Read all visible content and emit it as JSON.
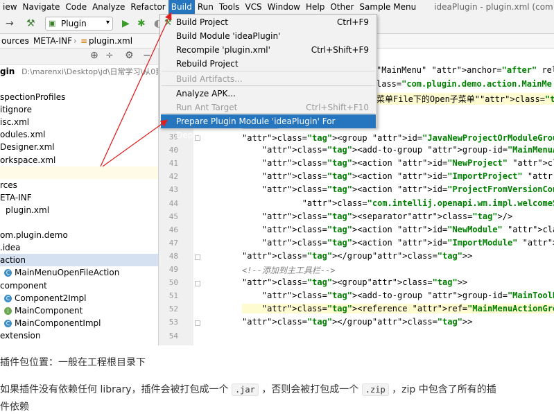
{
  "menubar": {
    "items": [
      "iew",
      "Navigate",
      "Code",
      "Analyze",
      "Refactor",
      "Build",
      "Run",
      "Tools",
      "VCS",
      "Window",
      "Help",
      "Other",
      "Sample Menu"
    ],
    "active": "Build",
    "window_title": "ideaPlugin - plugin.xml (com.your.co"
  },
  "toolbar": {
    "run_config": "Plugin"
  },
  "breadcrumb": {
    "items": [
      "ources",
      "META-INF",
      "plugin.xml"
    ]
  },
  "project_panel": {
    "root": {
      "name": "gin",
      "path": "D:\\marenxi\\Desktop\\jd\\日常学习\\从0到1"
    },
    "rows": [
      {
        "text": "spectionProfiles"
      },
      {
        "text": "itignore"
      },
      {
        "text": "isc.xml"
      },
      {
        "text": "odules.xml"
      },
      {
        "text": "Designer.xml"
      },
      {
        "text": "orkspace.xml"
      },
      {
        "text": ""
      },
      {
        "text": "rces"
      },
      {
        "text": "ETA-INF"
      },
      {
        "text": "plugin.xml"
      },
      {
        "text": ""
      },
      {
        "text": "om.plugin.demo"
      },
      {
        "text": ".idea"
      },
      {
        "text": "action"
      },
      {
        "text": "MainMenuOpenFileAction",
        "icon": "C"
      },
      {
        "text": "component"
      },
      {
        "text": "Component2Impl",
        "icon": "C"
      },
      {
        "text": "MainComponent",
        "icon": "I"
      },
      {
        "text": "MainComponentImpl",
        "icon": "C"
      },
      {
        "text": "extension"
      }
    ]
  },
  "build_menu": {
    "items": [
      {
        "label": "Build Project",
        "shortcut": "Ctrl+F9",
        "state": "normal"
      },
      {
        "label": "Build Module 'ideaPlugin'",
        "shortcut": "",
        "state": "normal"
      },
      {
        "label": "Recompile 'plugin.xml'",
        "shortcut": "Ctrl+Shift+F9",
        "state": "normal"
      },
      {
        "label": "Rebuild Project",
        "shortcut": "",
        "state": "normal"
      },
      {
        "label": "Build Artifacts...",
        "shortcut": "",
        "state": "disabled"
      },
      {
        "label": "Analyze APK...",
        "shortcut": "",
        "state": "normal"
      },
      {
        "label": "Run Ant Target",
        "shortcut": "Ctrl+Shift+F10",
        "state": "disabled"
      },
      {
        "label": "Prepare Plugin Module 'ideaPlugin' For Deployment",
        "shortcut": "",
        "state": "selected"
      }
    ]
  },
  "editor": {
    "top_lines": [
      "\"MainMenu\" anchor=\"after\" relative-",
      "lass=\"com.plugin.demo.action.MainMe",
      "菜单File下的Open子菜单\"/>"
    ],
    "line_numbers": [
      "39",
      "40",
      "41",
      "42",
      "43",
      "44",
      "45",
      "46",
      "47",
      "48",
      "49",
      "50",
      "51",
      "52",
      "53",
      "54"
    ],
    "lines": [
      "<group id=\"JavaNewProjectOrModuleGroup\" text=\"一级菜单\" popup=\"",
      "    <add-to-group group-id=\"MainMenuActionGroup\" anchor=\"befor",
      "    <action id=\"NewProject\" class=\"com.intellij.ide.actions.Ne",
      "    <action id=\"ImportProject\" class=\"com.intellij.ide.actions",
      "    <action id=\"ProjectFromVersionControl\"",
      "            class=\"com.intellij.openapi.wm.impl.welcomeScreen.",
      "    <separator/>",
      "    <action id=\"NewModule\" class=\"com.intellij.openapi.roots.u",
      "    <action id=\"ImportModule\" class=\"com.intellij.ide.actions.",
      "</group>",
      "<!--添加到主工具栏-->",
      "<group>",
      "    <add-to-group group-id=\"MainToolBar\" anchor=\"before\" relat",
      "    <reference ref=\"MainMenuActionGroup\"></reference>",
      "</group>",
      ""
    ]
  },
  "article": {
    "line1": "插件包位置：一般在工程根目录下",
    "line2_a": "如果插件没有依赖任何 library，插件会被打包成一个",
    "code_jar": ".jar",
    "line2_b": "，否则会被打包成一个",
    "code_zip": ".zip",
    "line2_c": "，zip 中包含了所有的插",
    "line3": "件依赖"
  },
  "colors": {
    "accent": "#2675bf",
    "annotation": "#e02020"
  }
}
